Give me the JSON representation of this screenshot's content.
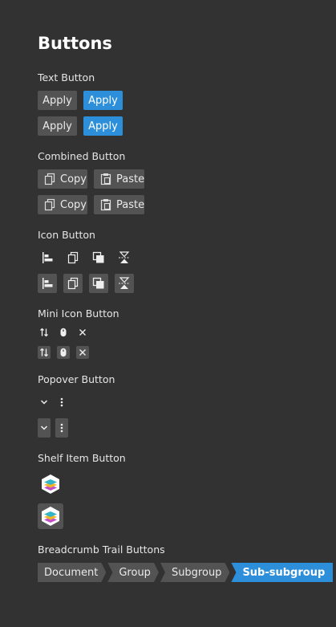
{
  "page_title": "Buttons",
  "sections": {
    "text_button": "Text Button",
    "combined_button": "Combined Button",
    "icon_button": "Icon Button",
    "mini_icon_button": "Mini Icon Button",
    "popover_button": "Popover Button",
    "shelf_item_button": "Shelf Item Button",
    "breadcrumb_trail_buttons": "Breadcrumb Trail Buttons"
  },
  "text_buttons": {
    "apply_label": "Apply"
  },
  "combined_buttons": {
    "copy_label": "Copy",
    "paste_label": "Paste"
  },
  "icon_buttons": [
    "align-left-icon",
    "copy-icon",
    "layers-icon",
    "flip-vertical-icon"
  ],
  "mini_icon_buttons": [
    "swap-icon",
    "mouse-icon",
    "close-icon"
  ],
  "popover_buttons": [
    "chevron-down-icon",
    "more-vertical-icon"
  ],
  "breadcrumbs": [
    "Document",
    "Group",
    "Subgroup",
    "Sub-subgroup"
  ],
  "colors": {
    "background": "#323232",
    "button": "#535353",
    "accent": "#2d8fd9",
    "text": "#e6e6e6"
  }
}
